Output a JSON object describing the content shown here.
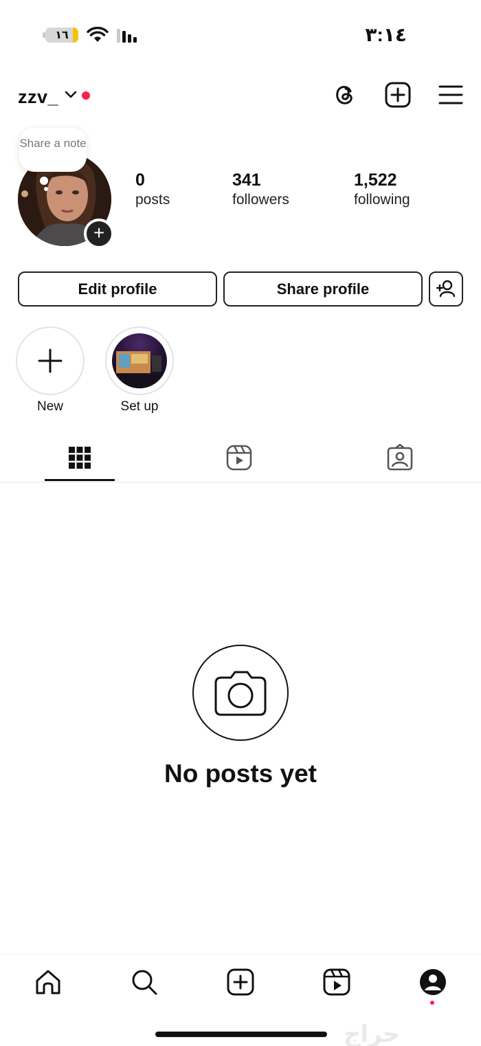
{
  "status_bar": {
    "battery_level": "١٦",
    "time": "٣:١٤"
  },
  "header": {
    "username": "zzv_",
    "icons": [
      "threads-icon",
      "create-plus-icon",
      "menu-icon"
    ],
    "notification_dot_color": "#ff1f4b"
  },
  "profile": {
    "note_bubble": "Share a note",
    "stats": [
      {
        "value": "0",
        "label": "posts"
      },
      {
        "value": "341",
        "label": "followers"
      },
      {
        "value": "1,522",
        "label": "following"
      }
    ]
  },
  "actions": {
    "edit_label": "Edit profile",
    "share_label": "Share profile",
    "discover_icon": "add-person-icon"
  },
  "highlights": [
    {
      "label": "New",
      "icon": "plus-icon"
    },
    {
      "label": "Set up",
      "icon": "highlight-thumbnail"
    }
  ],
  "tabs": [
    "grid-icon",
    "reels-icon",
    "tagged-icon"
  ],
  "empty_state": {
    "title": "No posts yet",
    "icon": "camera-icon"
  },
  "bottom_nav": [
    "home-icon",
    "search-icon",
    "create-icon",
    "reels-icon",
    "profile-icon"
  ],
  "watermark": "حراج",
  "colors": {
    "accent_red": "#ff1f4b",
    "text": "#111111",
    "border": "#222222"
  }
}
